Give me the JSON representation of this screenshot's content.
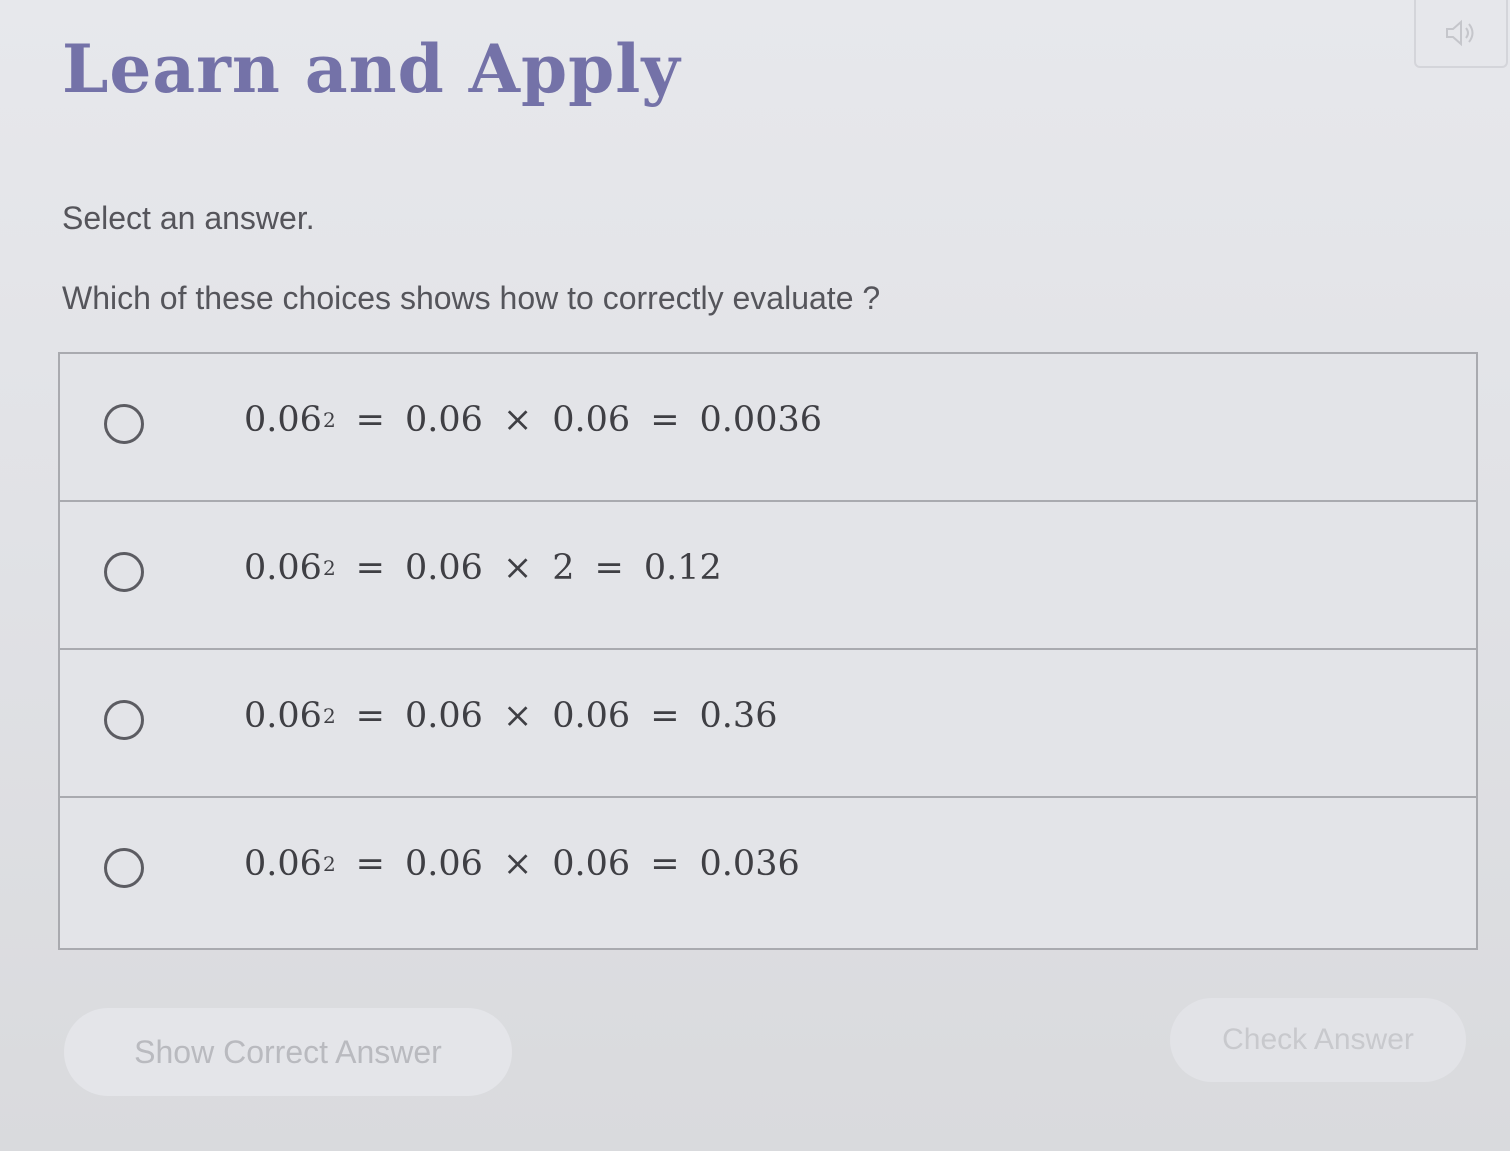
{
  "header": {
    "title": "Learn and Apply",
    "audio_icon": "speaker-icon"
  },
  "prompt": {
    "instruction": "Select an answer.",
    "question": "Which of these choices shows how to correctly evaluate ?"
  },
  "choices": [
    {
      "base": "0.06",
      "exponent": "2",
      "eq": "=",
      "operand1": "0.06",
      "times": "×",
      "operand2": "0.06",
      "result": "0.0036",
      "selected": false
    },
    {
      "base": "0.06",
      "exponent": "2",
      "eq": "=",
      "operand1": "0.06",
      "times": "×",
      "operand2": "2",
      "result": "0.12",
      "selected": false
    },
    {
      "base": "0.06",
      "exponent": "2",
      "eq": "=",
      "operand1": "0.06",
      "times": "×",
      "operand2": "0.06",
      "result": "0.36",
      "selected": false
    },
    {
      "base": "0.06",
      "exponent": "2",
      "eq": "=",
      "operand1": "0.06",
      "times": "×",
      "operand2": "0.06",
      "result": "0.036",
      "selected": false
    }
  ],
  "footer": {
    "show_answer_label": "Show Correct Answer",
    "check_answer_label": "Check Answer"
  },
  "colors": {
    "title": "#7472a8",
    "border": "#a9aaaf",
    "disabled_text": "#b9babf"
  }
}
